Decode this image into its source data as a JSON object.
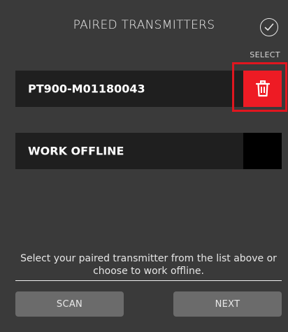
{
  "header": {
    "title": "PAIRED TRANSMITTERS",
    "confirm_icon": "check-circle-icon"
  },
  "select_label": "SELECT",
  "transmitters": [
    {
      "name": "PT900-M01180043",
      "action_icon": "trash-icon",
      "action_color": "#ee1b24",
      "highlight_color": "#e0161f"
    }
  ],
  "offline_option": {
    "label": "WORK OFFLINE"
  },
  "instruction": "Select your paired transmitter from the list above or choose to work offline.",
  "buttons": {
    "scan_label": "SCAN",
    "next_label": "NEXT"
  },
  "colors": {
    "background": "#3a3a3a",
    "row_background": "#1f1f1f",
    "button_background": "#6b6b6b"
  }
}
